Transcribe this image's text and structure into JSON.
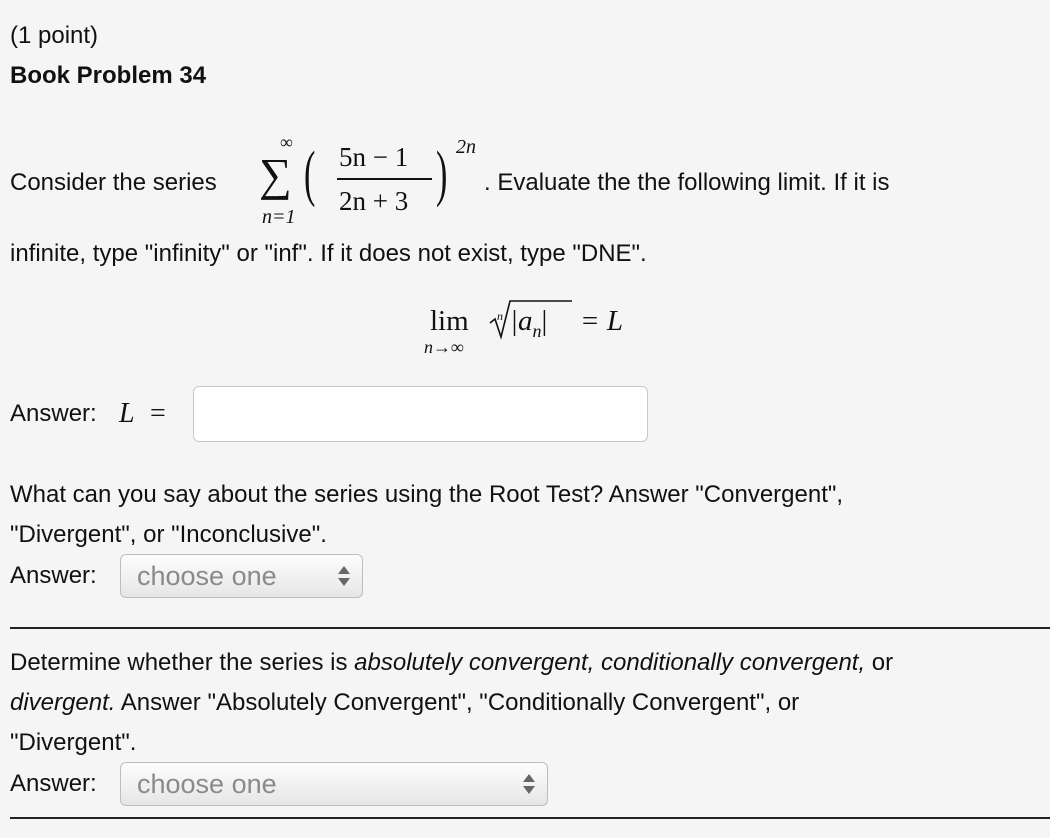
{
  "header": {
    "points": "(1 point)",
    "title": "Book Problem 34"
  },
  "intro": {
    "before_series": "Consider the series",
    "after_series": ". Evaluate the the following limit. If it is",
    "line2": "infinite, type \"infinity\" or \"inf\". If it does not exist, type \"DNE\"."
  },
  "series": {
    "sum_symbol": "∑",
    "upper": "∞",
    "lower": "n=1",
    "numerator": "5n − 1",
    "denominator": "2n + 3",
    "exponent": "2n"
  },
  "limit": {
    "lim": "lim",
    "sub": "n→∞",
    "root_index": "n",
    "radicand": "|a",
    "radicand_sub": "n",
    "radicand_end": "|",
    "rhs": "= L"
  },
  "answer1": {
    "label": "Answer:",
    "var": "L",
    "eq": "=",
    "value": ""
  },
  "question2": {
    "line1": "What can you say about the series using the Root Test? Answer \"Convergent\",",
    "line2": "\"Divergent\", or \"Inconclusive\".",
    "answer_label": "Answer:",
    "select_value": "choose one"
  },
  "question3": {
    "line1_pre": "Determine whether the series is ",
    "line1_it": "absolutely convergent, conditionally convergent,",
    "line1_post": " or",
    "line2_it": "divergent.",
    "line2_post": " Answer \"Absolutely Convergent\", \"Conditionally Convergent\", or",
    "line3": "\"Divergent\".",
    "answer_label": "Answer:",
    "select_value": "choose one"
  }
}
